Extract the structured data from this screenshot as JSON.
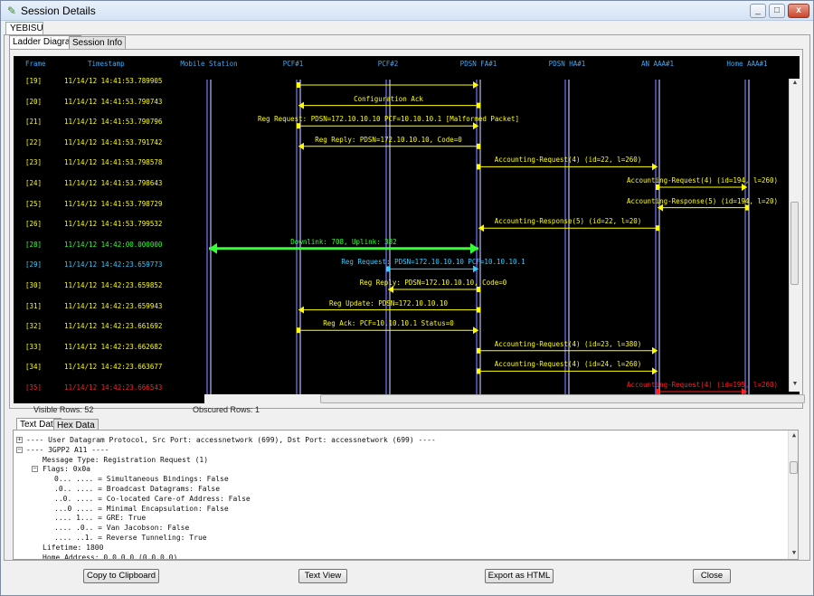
{
  "window": {
    "title": "Session Details",
    "app_icon": "session-icon",
    "min_label": "_",
    "max_label": "□",
    "close_label": "x"
  },
  "outer_tab": "YEBISU",
  "tabs": [
    {
      "label": "Ladder Diagram",
      "active": true
    },
    {
      "label": "Session Info",
      "active": false
    }
  ],
  "ladder": {
    "header_frame": "Frame",
    "header_timestamp": "Timestamp",
    "entities": [
      "Mobile Station",
      "PCF#1",
      "PCF#2",
      "PDSN FA#1",
      "PDSN HA#1",
      "AN AAA#1",
      "Home AAA#1"
    ],
    "rows": [
      {
        "frame": "[19]",
        "ts": "11/14/12 14:41:53.789905",
        "label": "",
        "from": 1,
        "to": 3,
        "color": "#ffff00"
      },
      {
        "frame": "[20]",
        "ts": "11/14/12 14:41:53.790743",
        "label": "Configuration Ack",
        "from": 3,
        "to": 1,
        "color": "#ffff00"
      },
      {
        "frame": "[21]",
        "ts": "11/14/12 14:41:53.790796",
        "label": "Reg Request:  PDSN=172.10.10.10  PCF=10.10.10.1 [Malformed Packet]",
        "from": 1,
        "to": 3,
        "color": "#ffff00"
      },
      {
        "frame": "[22]",
        "ts": "11/14/12 14:41:53.791742",
        "label": "Reg Reply:    PDSN=172.10.10.10, Code=0",
        "from": 3,
        "to": 1,
        "color": "#ffff00"
      },
      {
        "frame": "[23]",
        "ts": "11/14/12 14:41:53.798578",
        "label": "Accounting-Request(4)  (id=22, l=260)",
        "from": 3,
        "to": 5,
        "color": "#ffff00"
      },
      {
        "frame": "[24]",
        "ts": "11/14/12 14:41:53.798643",
        "label": "Accounting-Request(4)  (id=194, l=260)",
        "from": 5,
        "to": 6,
        "color": "#ffff00"
      },
      {
        "frame": "[25]",
        "ts": "11/14/12 14:41:53.798729",
        "label": "Accounting-Response(5)  (id=194, l=20)",
        "from": 6,
        "to": 5,
        "color": "#ffff00"
      },
      {
        "frame": "[26]",
        "ts": "11/14/12 14:41:53.799532",
        "label": "Accounting-Response(5)  (id=22, l=20)",
        "from": 5,
        "to": 3,
        "color": "#ffff00"
      },
      {
        "frame": "[28]",
        "ts": "11/14/12 14:42:00.000000",
        "label": "Downlink: 708, Uplink: 382",
        "from": 0,
        "to": 3,
        "color": "#33ff33",
        "both": true
      },
      {
        "frame": "[29]",
        "ts": "11/14/12 14:42:23.659773",
        "label": "Reg Request:  PDSN=172.10.10.10  PCF=10.10.10.1",
        "from": 2,
        "to": 3,
        "color": "#33ccff"
      },
      {
        "frame": "[30]",
        "ts": "11/14/12 14:42:23.659852",
        "label": "Reg Reply:    PDSN=172.10.10.10, Code=0",
        "from": 3,
        "to": 2,
        "color": "#ffff00"
      },
      {
        "frame": "[31]",
        "ts": "11/14/12 14:42:23.659943",
        "label": "Reg Update:   PDSN=172.10.10.10",
        "from": 3,
        "to": 1,
        "color": "#ffff00"
      },
      {
        "frame": "[32]",
        "ts": "11/14/12 14:42:23.661692",
        "label": "Reg Ack:      PCF=10.10.10.1 Status=0",
        "from": 1,
        "to": 3,
        "color": "#ffff00"
      },
      {
        "frame": "[33]",
        "ts": "11/14/12 14:42:23.662682",
        "label": "Accounting-Request(4)  (id=23, l=380)",
        "from": 3,
        "to": 5,
        "color": "#ffff00"
      },
      {
        "frame": "[34]",
        "ts": "11/14/12 14:42:23.663677",
        "label": "Accounting-Request(4)  (id=24, l=260)",
        "from": 3,
        "to": 5,
        "color": "#ffff00"
      },
      {
        "frame": "[35]",
        "ts": "11/14/12 14:42:23.666543",
        "label": "Accounting-Request(4)  (id=195, l=260)",
        "from": 5,
        "to": 6,
        "color": "#ff2020"
      }
    ]
  },
  "status": {
    "visible": "Visible Rows: 52",
    "obscured": "Obscured Rows: 1"
  },
  "lower_tabs": [
    {
      "label": "Text Data",
      "active": true
    },
    {
      "label": "Hex Data",
      "active": false
    }
  ],
  "tree": [
    {
      "text": "---- User Datagram Protocol, Src Port: accessnetwork (699), Dst Port: accessnetwork (699) ----",
      "level": 0,
      "exp": "+"
    },
    {
      "text": "---- 3GPP2 A11 ----",
      "level": 0,
      "exp": "-"
    },
    {
      "text": "Message Type: Registration Request (1)",
      "level": 1,
      "exp": ""
    },
    {
      "text": "Flags: 0x0a",
      "level": 1,
      "exp": "-"
    },
    {
      "text": "0... .... = Simultaneous Bindings: False",
      "level": 2,
      "exp": ""
    },
    {
      "text": ".0.. .... = Broadcast Datagrams: False",
      "level": 2,
      "exp": ""
    },
    {
      "text": "..0. .... = Co-located Care-of Address: False",
      "level": 2,
      "exp": ""
    },
    {
      "text": "...0 .... = Minimal Encapsulation: False",
      "level": 2,
      "exp": ""
    },
    {
      "text": ".... 1... = GRE: True",
      "level": 2,
      "exp": ""
    },
    {
      "text": ".... .0.. = Van Jacobson: False",
      "level": 2,
      "exp": ""
    },
    {
      "text": ".... ..1. = Reverse Tunneling: True",
      "level": 2,
      "exp": ""
    },
    {
      "text": "Lifetime: 1800",
      "level": 1,
      "exp": ""
    },
    {
      "text": "Home Address: 0.0.0.0 (0.0.0.0)",
      "level": 1,
      "exp": ""
    }
  ],
  "buttons": {
    "copy": "Copy to Clipboard",
    "text_view": "Text View",
    "export": "Export as HTML",
    "close": "Close"
  }
}
